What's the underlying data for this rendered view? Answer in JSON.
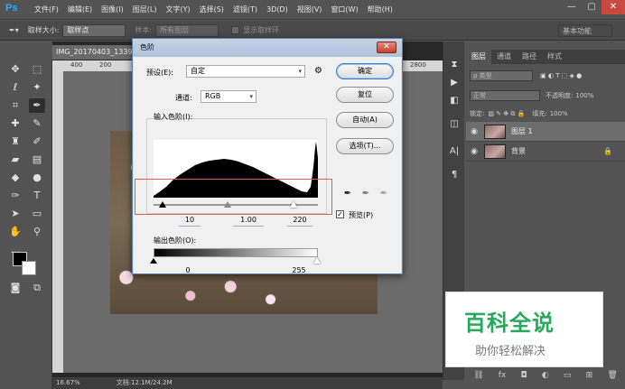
{
  "app": {
    "logo": "Ps"
  },
  "menu": [
    "文件(F)",
    "编辑(E)",
    "图像(I)",
    "图层(L)",
    "文字(Y)",
    "选择(S)",
    "滤镜(T)",
    "3D(D)",
    "视图(V)",
    "窗口(W)",
    "帮助(H)"
  ],
  "window_buttons": {
    "minimize": "—",
    "maximize": "▢",
    "close": "✕"
  },
  "options": {
    "sample_size_label": "取样大小:",
    "sample_size_value": "取样点",
    "sample_label": "样本:",
    "sample_value": "所有图层",
    "show_ring": "显示取样环",
    "workspace": "基本功能"
  },
  "document": {
    "tab": "IMG_20170403_1339...",
    "ruler": {
      "t400": "400",
      "t200": "200",
      "t2800": "2800"
    },
    "zoom": "16.67%",
    "doc_size": "文档:12.1M/24.2M"
  },
  "layers_panel": {
    "tabs": [
      "图层",
      "通道",
      "路径",
      "样式"
    ],
    "filter_type": "ρ 类型",
    "blend_mode": "正常",
    "opacity_label": "不透明度:",
    "opacity": "100%",
    "lock_label": "锁定:",
    "fill_label": "填充:",
    "fill": "100%",
    "layers": [
      {
        "name": "图层 1",
        "selected": true
      },
      {
        "name": "背景",
        "selected": false,
        "locked": true
      }
    ]
  },
  "levels_dialog": {
    "title": "色阶",
    "preset_label": "预设(E):",
    "preset_value": "自定",
    "channel_label": "通道:",
    "channel_value": "RGB",
    "input_label": "输入色阶(I):",
    "input_black": "10",
    "input_gamma": "1.00",
    "input_white": "220",
    "output_label": "输出色阶(O):",
    "output_black": "0",
    "output_white": "255",
    "buttons": {
      "ok": "确定",
      "reset": "复位",
      "auto": "自动(A)",
      "options": "选项(T)..."
    },
    "preview_label": "预览(P)",
    "preview_checked": true
  },
  "watermark": {
    "main": "百科全说",
    "sub": "助你轻松解决"
  },
  "colors": {
    "accent": "#31a8ff",
    "watermark_green": "#27a85a",
    "highlight": "#e05a5a"
  }
}
